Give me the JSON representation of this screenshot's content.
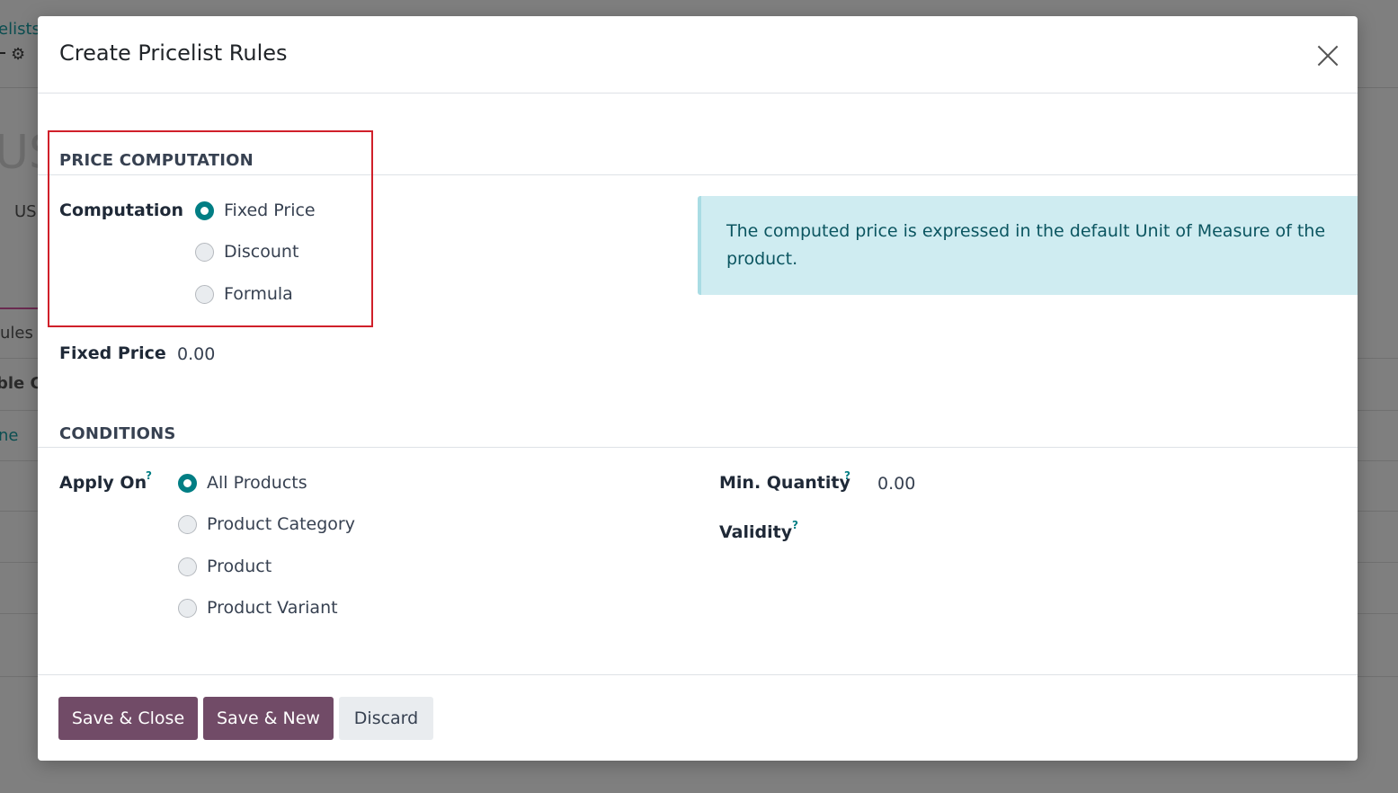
{
  "background": {
    "breadcrumb": "elists",
    "title": "US",
    "currency": "US",
    "tab": "ules",
    "column": "ble C",
    "link": "ne"
  },
  "modal": {
    "title": "Create Pricelist Rules",
    "price_computation": {
      "section_title": "PRICE COMPUTATION",
      "computation_label": "Computation",
      "options": [
        "Fixed Price",
        "Discount",
        "Formula"
      ],
      "selected": "Fixed Price",
      "fixed_price_label": "Fixed Price",
      "fixed_price_value": "0.00",
      "info_text": "The computed price is expressed in the default Unit of Measure of the product."
    },
    "conditions": {
      "section_title": "CONDITIONS",
      "apply_on_label": "Apply On",
      "apply_on_options": [
        "All Products",
        "Product Category",
        "Product",
        "Product Variant"
      ],
      "apply_on_selected": "All Products",
      "min_quantity_label": "Min. Quantity",
      "min_quantity_value": "0.00",
      "validity_label": "Validity",
      "help_marker": "?"
    },
    "footer": {
      "save_close": "Save & Close",
      "save_new": "Save & New",
      "discard": "Discard"
    }
  },
  "colors": {
    "primary": "#714b67",
    "accent": "#017e84",
    "highlight": "#d0202a",
    "info_bg": "#cfecf1"
  },
  "icons": {
    "close": "close-icon",
    "settings": "gear-icon",
    "help": "help-icon"
  }
}
